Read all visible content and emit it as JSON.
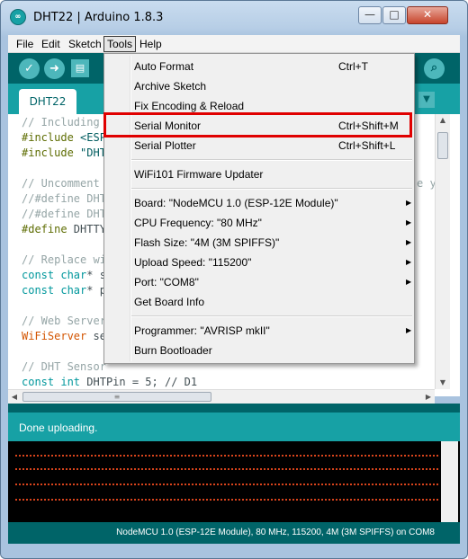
{
  "window": {
    "title": "DHT22 | Arduino 1.8.3",
    "app_icon_glyph": "∞",
    "minimize_glyph": "—",
    "maximize_glyph": "□",
    "close_glyph": "✕"
  },
  "menubar": {
    "items": [
      "File",
      "Edit",
      "Sketch",
      "Tools",
      "Help"
    ],
    "active": "Tools"
  },
  "toolbar": {
    "verify_glyph": "✓",
    "upload_glyph": "➜",
    "new_glyph": "▤",
    "serial_monitor_glyph": "⌕"
  },
  "tabs": {
    "active_tab": "DHT22",
    "dropdown_glyph": "▼"
  },
  "editor": {
    "lines": [
      [
        {
          "t": "// Including",
          "c": "comment"
        }
      ],
      [
        {
          "t": "#include",
          "c": "directive"
        },
        {
          "t": " <ESP",
          "c": "string"
        }
      ],
      [
        {
          "t": "#include",
          "c": "directive"
        },
        {
          "t": " \"DHT",
          "c": "string"
        }
      ],
      [],
      [
        {
          "t": "// Uncomment",
          "c": "comment"
        }
      ],
      [
        {
          "t": "//#define DHT",
          "c": "comment"
        }
      ],
      [
        {
          "t": "//#define DHT",
          "c": "comment"
        }
      ],
      [
        {
          "t": "#define",
          "c": "directive"
        },
        {
          "t": " DHTTY",
          "c": "plain"
        }
      ],
      [],
      [
        {
          "t": "// Replace wi",
          "c": "comment"
        }
      ],
      [
        {
          "t": "const",
          "c": "keyword"
        },
        {
          "t": " ",
          "c": "plain"
        },
        {
          "t": "char",
          "c": "keyword"
        },
        {
          "t": "* s",
          "c": "plain"
        }
      ],
      [
        {
          "t": "const",
          "c": "keyword"
        },
        {
          "t": " ",
          "c": "plain"
        },
        {
          "t": "char",
          "c": "keyword"
        },
        {
          "t": "* p",
          "c": "plain"
        }
      ],
      [],
      [
        {
          "t": "// Web Server",
          "c": "comment"
        }
      ],
      [
        {
          "t": "WiFiServer",
          "c": "type"
        },
        {
          "t": " se",
          "c": "plain"
        }
      ],
      [],
      [
        {
          "t": "// DHT Sensor",
          "c": "comment"
        }
      ],
      [
        {
          "t": "const",
          "c": "keyword"
        },
        {
          "t": " ",
          "c": "plain"
        },
        {
          "t": "int",
          "c": "keyword"
        },
        {
          "t": " DHTPin = 5; // D1",
          "c": "plain"
        }
      ]
    ],
    "overflow_fragment": "e y"
  },
  "status": {
    "message": "Done uploading."
  },
  "footer": {
    "board_info": "NodeMCU 1.0 (ESP-12E Module), 80 MHz, 115200, 4M (3M SPIFFS) on COM8"
  },
  "tools_menu": {
    "items": [
      {
        "label": "Auto Format",
        "shortcut": "Ctrl+T"
      },
      {
        "label": "Archive Sketch"
      },
      {
        "label": "Fix Encoding & Reload"
      },
      {
        "label": "Serial Monitor",
        "shortcut": "Ctrl+Shift+M",
        "highlighted": true
      },
      {
        "label": "Serial Plotter",
        "shortcut": "Ctrl+Shift+L"
      },
      {
        "separator": true
      },
      {
        "label": "WiFi101 Firmware Updater"
      },
      {
        "separator": true
      },
      {
        "label": "Board: \"NodeMCU 1.0 (ESP-12E Module)\"",
        "submenu": true
      },
      {
        "label": "CPU Frequency: \"80 MHz\"",
        "submenu": true
      },
      {
        "label": "Flash Size: \"4M (3M SPIFFS)\"",
        "submenu": true
      },
      {
        "label": "Upload Speed: \"115200\"",
        "submenu": true
      },
      {
        "label": "Port: \"COM8\"",
        "submenu": true
      },
      {
        "label": "Get Board Info"
      },
      {
        "separator": true
      },
      {
        "label": "Programmer: \"AVRISP mkII\"",
        "submenu": true
      },
      {
        "label": "Burn Bootloader"
      }
    ],
    "submenu_glyph": "▶"
  },
  "colors": {
    "arduino_dark_teal": "#006468",
    "arduino_teal": "#17a1a5",
    "highlight_red": "#e00000"
  }
}
